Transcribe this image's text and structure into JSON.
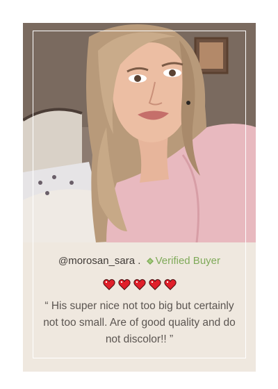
{
  "review": {
    "handle_prefix": "@",
    "handle": "morosan_sara",
    "separator": " .",
    "verified_label": "Verified Buyer",
    "rating": 5,
    "quote": "“ His super nice not too big but certainly not too small. Are of good quality and do not discolor!! ”"
  },
  "icons": {
    "verified": "gem-icon",
    "rating": "heart-icon"
  },
  "colors": {
    "card_background": "#efe8df",
    "verified_green": "#7faa59",
    "heart_red": "#e0202b",
    "frame_border": "#ffffff"
  }
}
